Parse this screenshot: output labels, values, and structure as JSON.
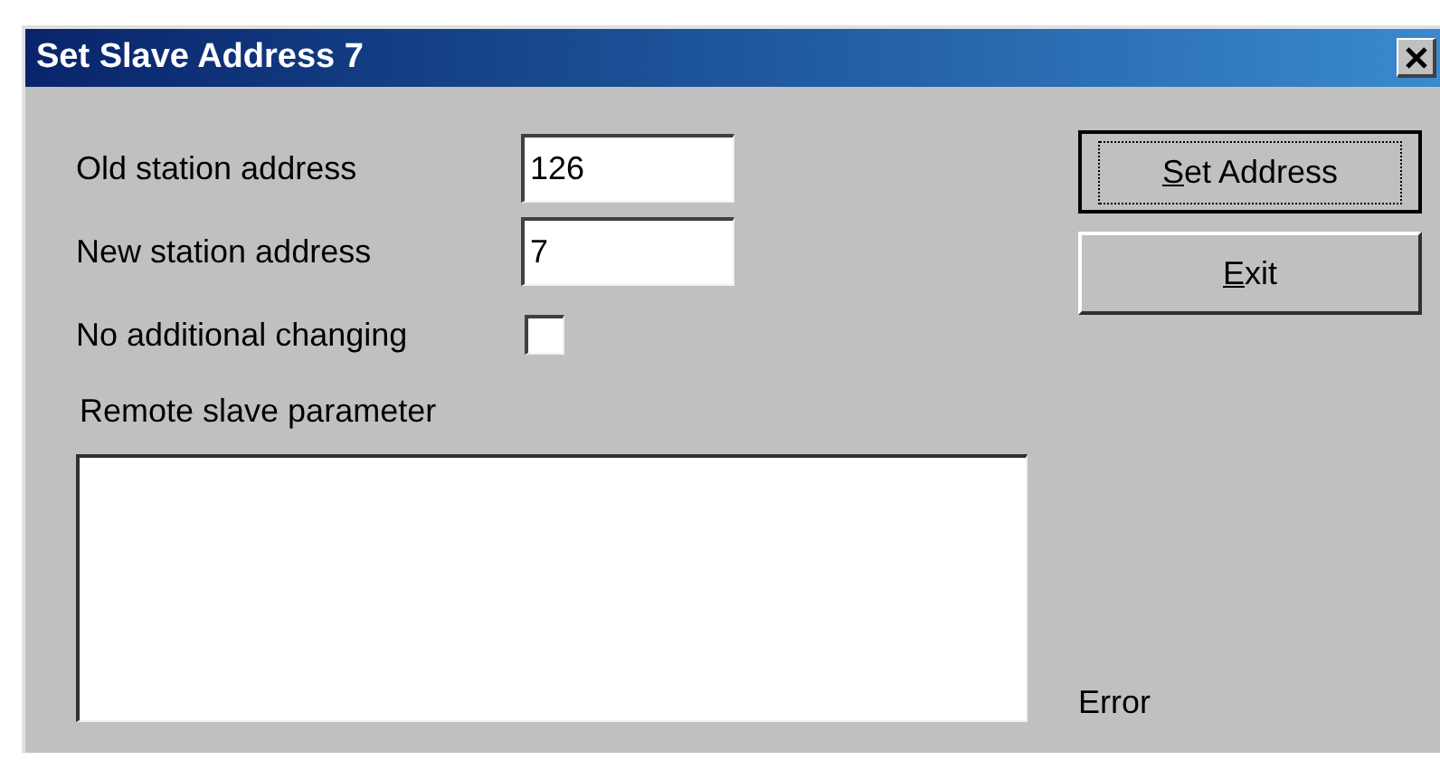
{
  "window": {
    "title": "Set Slave Address 7"
  },
  "fields": [
    {
      "label": "Old station address",
      "value": "126"
    },
    {
      "label": "New station address",
      "value": "7"
    }
  ],
  "checkbox": {
    "label": "No additional changing",
    "checked": false
  },
  "remote_parameter": {
    "label": "Remote slave parameter"
  },
  "buttons": [
    {
      "label": "Set Address",
      "default": true
    },
    {
      "label": "Exit",
      "default": false
    }
  ],
  "status": "Error"
}
